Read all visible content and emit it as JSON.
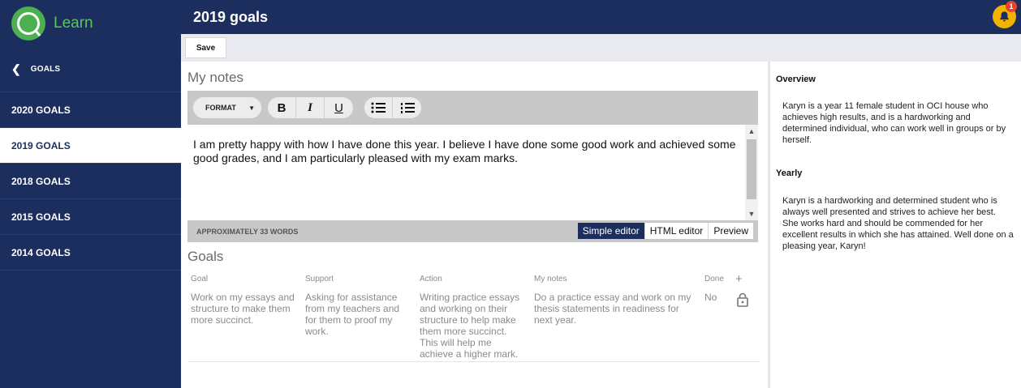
{
  "app": {
    "name": "Learn"
  },
  "sidebar": {
    "back_label": "GOALS",
    "items": [
      {
        "label": "2020 GOALS",
        "active": false
      },
      {
        "label": "2019 GOALS",
        "active": true
      },
      {
        "label": "2018 GOALS",
        "active": false
      },
      {
        "label": "2015 GOALS",
        "active": false
      },
      {
        "label": "2014 GOALS",
        "active": false
      }
    ]
  },
  "header": {
    "title": "2019 goals",
    "notification_count": "1"
  },
  "toolbar": {
    "save_label": "Save"
  },
  "notes": {
    "title": "My notes",
    "format_label": "FORMAT",
    "content": "I am pretty happy with how I have done this year. I believe I have done some good work and achieved some good grades, and I am particularly pleased with my exam marks.",
    "word_count": "APPROXIMATELY 33 WORDS",
    "modes": [
      "Simple editor",
      "HTML editor",
      "Preview"
    ],
    "active_mode": "Simple editor"
  },
  "goals": {
    "title": "Goals",
    "columns": [
      "Goal",
      "Support",
      "Action",
      "My notes",
      "Done",
      "+"
    ],
    "rows": [
      {
        "goal": "Work on my essays and structure to make them more succinct.",
        "support": "Asking for assistance from my teachers and for them to proof my work.",
        "action": "Writing practice essays and working on their structure to help make them more succinct. This will help me achieve a higher mark.",
        "my_notes": "Do a practice essay and work on my thesis statements in readiness for next year.",
        "done": "No"
      }
    ]
  },
  "right_panel": {
    "overview_heading": "Overview",
    "overview_text": "Karyn is a year 11 female student in OCI house who achieves high results, and is a hardworking and determined individual, who can work well in groups or by herself.",
    "yearly_heading": "Yearly",
    "yearly_text": "Karyn is a hardworking and determined student who is always well presented and strives to achieve her best. She works hard and should be commended for her excellent results in which she has attained. Well done on a pleasing year, Karyn!"
  },
  "colors": {
    "navy": "#1c2e5e",
    "brand_green": "#5cc45f",
    "bell": "#f0b400",
    "badge": "#e8402b"
  }
}
